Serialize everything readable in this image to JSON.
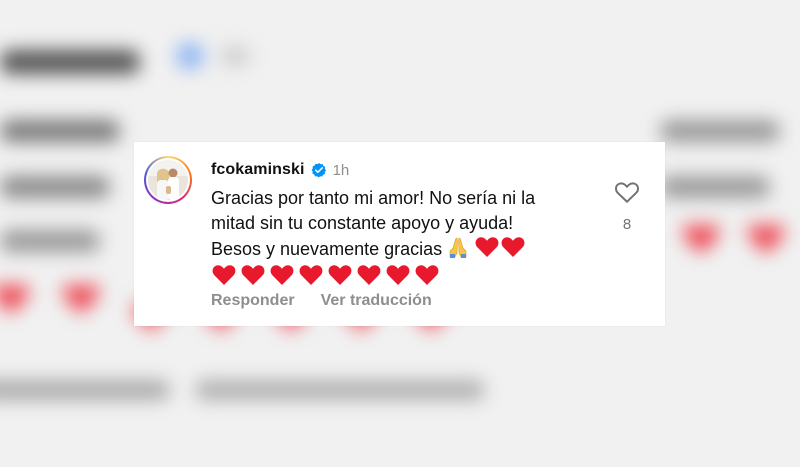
{
  "comment": {
    "username": "fcokaminski",
    "verified_icon": "verified-badge-icon",
    "time": "1h",
    "text_line1": "Gracias por tanto mi amor! No sería ni la",
    "text_line2": "mitad sin tu constante apoyo y ayuda!",
    "text_line3": "Besos y nuevamente gracias",
    "emoji_after_line3": [
      "pray-emoji",
      "heart-emoji",
      "heart-emoji"
    ],
    "heart_row_count": 8,
    "like_icon": "heart-outline-icon",
    "like_count": "8",
    "reply_label": "Responder",
    "translate_label": "Ver traducción"
  },
  "colors": {
    "heart": "#e8192c",
    "verified": "#0095f6",
    "muted": "#8e8e8e"
  }
}
